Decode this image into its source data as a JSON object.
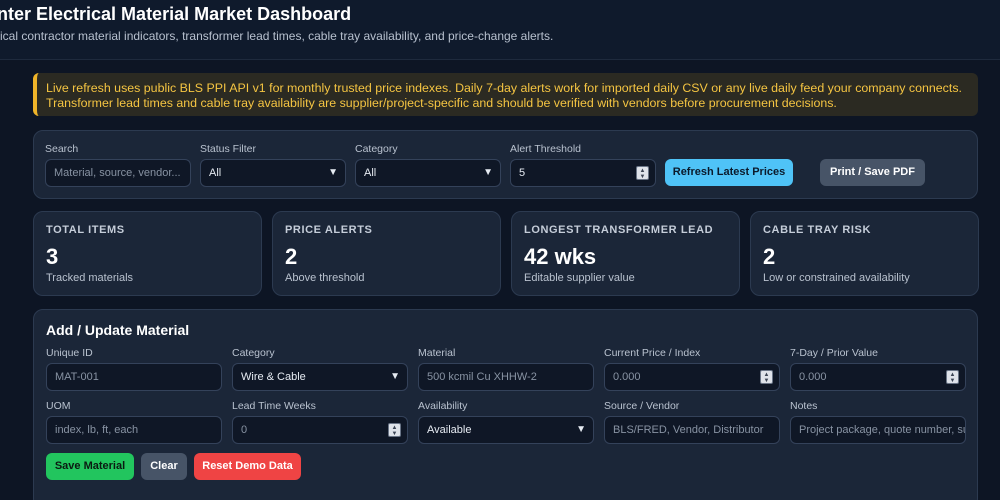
{
  "header": {
    "title": "nter Electrical Material Market Dashboard",
    "subtitle": "ical contractor material indicators, transformer lead times, cable tray availability, and price-change alerts."
  },
  "notice": {
    "line1": "Live refresh uses public BLS PPI API v1 for monthly trusted price indexes. Daily 7-day alerts work for imported daily CSV or any live daily feed your company connects.",
    "line2": "Transformer lead times and cable tray availability are supplier/project-specific and should be verified with vendors before procurement decisions."
  },
  "filters": {
    "search_label": "Search",
    "search_placeholder": "Material, source, vendor...",
    "status_label": "Status Filter",
    "status_value": "All",
    "category_label": "Category",
    "category_value": "All",
    "threshold_label": "Alert Threshold",
    "threshold_value": "5",
    "refresh_label": "Refresh Latest Prices",
    "print_label": "Print / Save PDF"
  },
  "stats": [
    {
      "title": "TOTAL ITEMS",
      "value": "3",
      "sub": "Tracked materials"
    },
    {
      "title": "PRICE ALERTS",
      "value": "2",
      "sub": "Above threshold"
    },
    {
      "title": "LONGEST TRANSFORMER LEAD",
      "value": "42 wks",
      "sub": "Editable supplier value"
    },
    {
      "title": "CABLE TRAY RISK",
      "value": "2",
      "sub": "Low or constrained availability"
    }
  ],
  "form": {
    "title": "Add / Update Material",
    "unique_id_label": "Unique ID",
    "unique_id_placeholder": "MAT-001",
    "category_label": "Category",
    "category_value": "Wire & Cable",
    "material_label": "Material",
    "material_placeholder": "500 kcmil Cu XHHW-2",
    "current_price_label": "Current Price / Index",
    "current_price_placeholder": "0.000",
    "prior_value_label": "7-Day / Prior Value",
    "prior_value_placeholder": "0.000",
    "uom_label": "UOM",
    "uom_placeholder": "index, lb, ft, each",
    "lead_time_label": "Lead Time Weeks",
    "lead_time_placeholder": "0",
    "availability_label": "Availability",
    "availability_value": "Available",
    "source_label": "Source / Vendor",
    "source_placeholder": "BLS/FRED, Vendor, Distributor",
    "notes_label": "Notes",
    "notes_placeholder": "Project package, quote number, sub",
    "save_label": "Save Material",
    "clear_label": "Clear",
    "reset_label": "Reset Demo Data"
  },
  "colors": {
    "accent": "#4fc3f7",
    "save": "#22c55e",
    "reset": "#ef4444",
    "warning": "#f5c542"
  }
}
